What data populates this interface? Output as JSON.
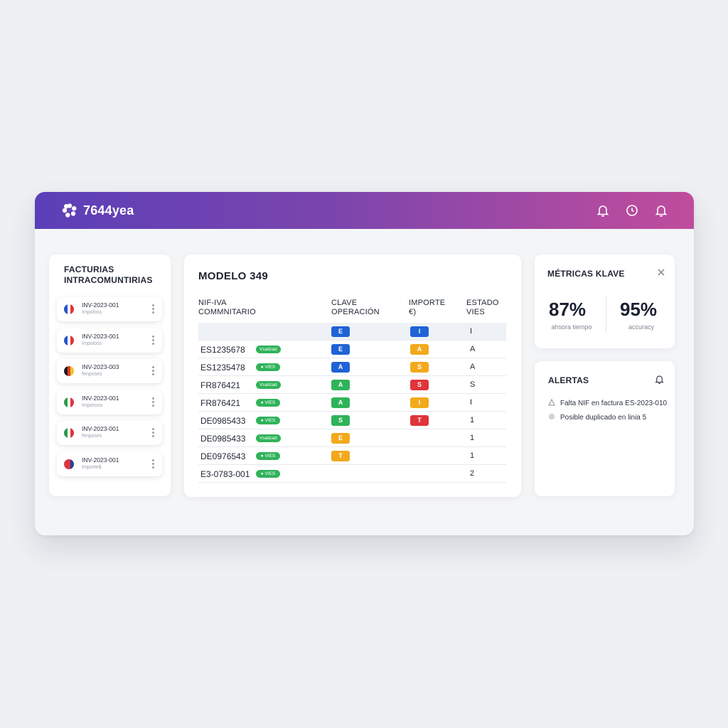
{
  "app": {
    "title": "7644yea"
  },
  "left_panel": {
    "title": "FACTURIAS INTRACOMUNTIRIAS",
    "invoices": [
      {
        "id": "INV-2023-001",
        "sub": "Impoloss",
        "flag": [
          "#2553c9",
          "#ffffff",
          "#e0343b"
        ]
      },
      {
        "id": "INV-2023-001",
        "sub": "Impoloss",
        "flag": [
          "#2553c9",
          "#ffffff",
          "#e0343b"
        ]
      },
      {
        "id": "INV-2023-003",
        "sub": "fenposes",
        "flag": [
          "#1d1d1d",
          "#e33b2e",
          "#f3c22b"
        ]
      },
      {
        "id": "INV-2023-001",
        "sub": "Imporoos",
        "flag": [
          "#2a9a4a",
          "#ffffff",
          "#e0343b"
        ]
      },
      {
        "id": "INV-2023-001",
        "sub": "fenposes",
        "flag": [
          "#2a9a4a",
          "#ffffff",
          "#e0343b"
        ]
      },
      {
        "id": "INV-2023-001",
        "sub": "Importe$",
        "flag": [
          "#d93545",
          "#d93545",
          "#2c3f8f"
        ]
      }
    ]
  },
  "modelo": {
    "title": "MODELO 349",
    "headers": {
      "nif": [
        "NIF-IVA",
        "COMMNITARIO"
      ],
      "clave": [
        "CLAVE",
        "OPERACIÓN"
      ],
      "importe": [
        "IMPORTE",
        "€)"
      ],
      "estado": [
        "ESTADO",
        "VIES"
      ]
    },
    "rows": [
      {
        "nif": "",
        "badge": "",
        "clave": "E",
        "clave_color": "#1f63d6",
        "importe": "I",
        "importe_color": "#1f63d6",
        "estado": "I"
      },
      {
        "nif": "ES1235678",
        "badge": "Vsalizad",
        "clave": "E",
        "clave_color": "#1f63d6",
        "importe": "A",
        "importe_color": "#f2a91c",
        "estado": "A"
      },
      {
        "nif": "ES1235478",
        "badge": "● VIES",
        "clave": "A",
        "clave_color": "#1f63d6",
        "importe": "S",
        "importe_color": "#f2a91c",
        "estado": "A"
      },
      {
        "nif": "FR876421",
        "badge": "Vsalizad",
        "clave": "A",
        "clave_color": "#2fb35a",
        "importe": "S",
        "importe_color": "#e0343b",
        "estado": "S"
      },
      {
        "nif": "FR876421",
        "badge": "● VIES",
        "clave": "A",
        "clave_color": "#2fb35a",
        "importe": "I",
        "importe_color": "#f2a91c",
        "estado": "I"
      },
      {
        "nif": "DE0985433",
        "badge": "● VIES",
        "clave": "S",
        "clave_color": "#2fb35a",
        "importe": "T",
        "importe_color": "#e0343b",
        "estado": "1"
      },
      {
        "nif": "DE0985433",
        "badge": "Vsalizad",
        "clave": "E",
        "clave_color": "#f2a91c",
        "importe": "",
        "importe_color": "",
        "estado": "1"
      },
      {
        "nif": "DE0976543",
        "badge": "● VIES",
        "clave": "T",
        "clave_color": "#f2a91c",
        "importe": "",
        "importe_color": "",
        "estado": "1"
      },
      {
        "nif": "E3-0783-001",
        "badge": "● VIES",
        "clave": "",
        "clave_color": "",
        "importe": "",
        "importe_color": "",
        "estado": "2"
      }
    ]
  },
  "metrics": {
    "title": "MÉTRICAS KLAVE",
    "items": [
      {
        "value": "87%",
        "label": "ahsora tiempo"
      },
      {
        "value": "95%",
        "label": "accuracy"
      }
    ]
  },
  "alerts": {
    "title": "ALERTAS",
    "items": [
      {
        "text": "Falta NIF en factura ES-2023-010"
      },
      {
        "text": "Posible duplicado en linia 5"
      }
    ]
  }
}
